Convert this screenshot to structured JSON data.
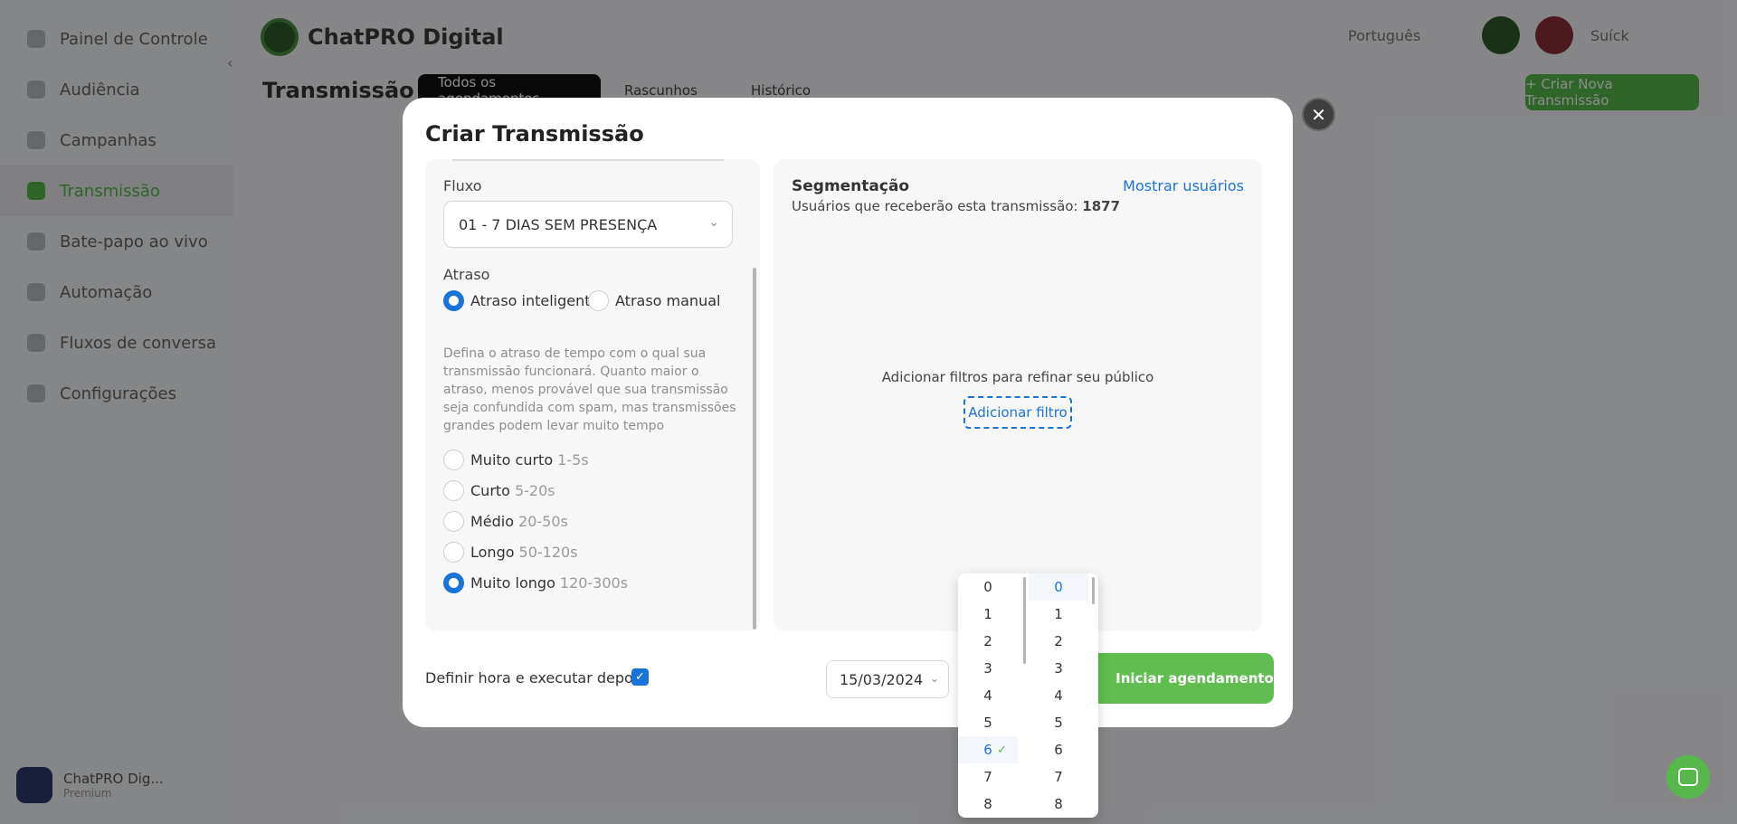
{
  "sidebar": {
    "items": [
      {
        "label": "Painel de Controle"
      },
      {
        "label": "Audiência"
      },
      {
        "label": "Campanhas"
      },
      {
        "label": "Transmissão"
      },
      {
        "label": "Bate-papo ao vivo"
      },
      {
        "label": "Automação"
      },
      {
        "label": "Fluxos de conversa"
      },
      {
        "label": "Configurações"
      }
    ],
    "user": {
      "name": "ChatPRO Dig...",
      "status": "Premium"
    }
  },
  "topbar": {
    "brand": "ChatPRO Digital",
    "language": "Português",
    "user": "Suíck"
  },
  "page": {
    "title": "Transmissão",
    "tabs": [
      {
        "label": "Todos os agendamentos"
      },
      {
        "label": "Rascunhos"
      },
      {
        "label": "Histórico"
      }
    ],
    "new_button": "+ Criar Nova Transmissão"
  },
  "modal": {
    "title": "Criar Transmissão",
    "close": "✕",
    "flow": {
      "label": "Fluxo",
      "value": "01 - 7 DIAS SEM PRESENÇA"
    },
    "delay": {
      "label": "Atraso",
      "modes": [
        {
          "label": "Atraso inteligente",
          "checked": true
        },
        {
          "label": "Atraso manual",
          "checked": false
        }
      ],
      "help": "Defina o atraso de tempo com o qual sua transmissão funcionará. Quanto maior o atraso, menos provável que sua transmissão seja confundida com spam, mas transmissões grandes podem levar muito tempo",
      "options": [
        {
          "label": "Muito curto",
          "range": "1-5s",
          "checked": false
        },
        {
          "label": "Curto",
          "range": "5-20s",
          "checked": false
        },
        {
          "label": "Médio",
          "range": "20-50s",
          "checked": false
        },
        {
          "label": "Longo",
          "range": "50-120s",
          "checked": false
        },
        {
          "label": "Muito longo",
          "range": "120-300s",
          "checked": true
        }
      ]
    },
    "segmentation": {
      "title": "Segmentação",
      "recipients_label": "Usuários que receberão esta transmissão:",
      "recipients_count": "1877",
      "show_users": "Mostrar usuários",
      "empty_text": "Adicionar filtros para refinar seu público",
      "add_filter": "Adicionar filtro"
    },
    "footer": {
      "schedule_label": "Definir hora e executar depois",
      "schedule_checked": true,
      "date": "15/03/2024",
      "start_button": "Iniciar agendamento"
    }
  },
  "time_picker": {
    "hours": [
      "0",
      "1",
      "2",
      "3",
      "4",
      "5",
      "6",
      "7",
      "8"
    ],
    "minutes": [
      "0",
      "1",
      "2",
      "3",
      "4",
      "5",
      "6",
      "7",
      "8"
    ],
    "selected_hour": "6",
    "selected_minute": "0"
  },
  "colors": {
    "accent": "#1a73d9",
    "brand_green": "#56b84a"
  }
}
